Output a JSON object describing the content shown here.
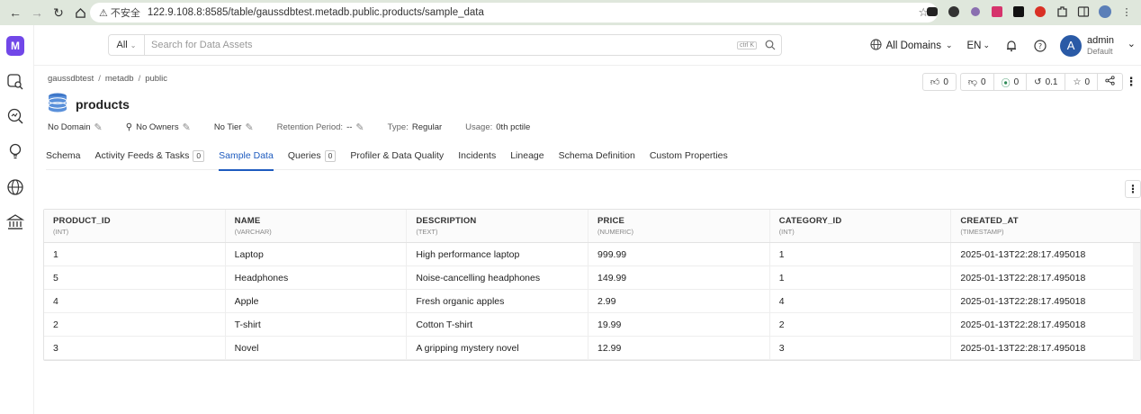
{
  "browser": {
    "insecure_label": "不安全",
    "url": "122.9.108.8:8585/table/gaussdbtest.metadb.public.products/sample_data"
  },
  "search": {
    "scope": "All",
    "placeholder": "Search for Data Assets",
    "shortcut": "ctrl K"
  },
  "header": {
    "domains": "All Domains",
    "language": "EN",
    "user_initial": "A",
    "user_name": "admin",
    "user_role": "Default"
  },
  "breadcrumb": [
    "gaussdbtest",
    "metadb",
    "public"
  ],
  "entity": {
    "title": "products",
    "up_votes": "0",
    "down_votes": "0",
    "followers": "0",
    "version": "0.1",
    "stars": "0"
  },
  "meta": {
    "domain": "No Domain",
    "owners": "No Owners",
    "tier": "No Tier",
    "retention_label": "Retention Period:",
    "retention_value": "--",
    "type_label": "Type:",
    "type_value": "Regular",
    "usage_label": "Usage:",
    "usage_value": "0th pctile"
  },
  "tabs": [
    {
      "label": "Schema"
    },
    {
      "label": "Activity Feeds & Tasks",
      "count": "0"
    },
    {
      "label": "Sample Data",
      "active": true
    },
    {
      "label": "Queries",
      "count": "0"
    },
    {
      "label": "Profiler & Data Quality"
    },
    {
      "label": "Incidents"
    },
    {
      "label": "Lineage"
    },
    {
      "label": "Schema Definition"
    },
    {
      "label": "Custom Properties"
    }
  ],
  "table": {
    "columns": [
      {
        "name": "PRODUCT_ID",
        "type": "(INT)"
      },
      {
        "name": "NAME",
        "type": "(VARCHAR)"
      },
      {
        "name": "DESCRIPTION",
        "type": "(TEXT)"
      },
      {
        "name": "PRICE",
        "type": "(NUMERIC)"
      },
      {
        "name": "CATEGORY_ID",
        "type": "(INT)"
      },
      {
        "name": "CREATED_AT",
        "type": "(TIMESTAMP)"
      }
    ],
    "rows": [
      [
        "1",
        "Laptop",
        "High performance laptop",
        "999.99",
        "1",
        "2025-01-13T22:28:17.495018"
      ],
      [
        "5",
        "Headphones",
        "Noise-cancelling headphones",
        "149.99",
        "1",
        "2025-01-13T22:28:17.495018"
      ],
      [
        "4",
        "Apple",
        "Fresh organic apples",
        "2.99",
        "4",
        "2025-01-13T22:28:17.495018"
      ],
      [
        "2",
        "T-shirt",
        "Cotton T-shirt",
        "19.99",
        "2",
        "2025-01-13T22:28:17.495018"
      ],
      [
        "3",
        "Novel",
        "A gripping mystery novel",
        "12.99",
        "3",
        "2025-01-13T22:28:17.495018"
      ]
    ]
  },
  "colors": {
    "accent": "#1e5bbf",
    "brand": "#7147e8",
    "avatar": "#2a5aa6"
  }
}
